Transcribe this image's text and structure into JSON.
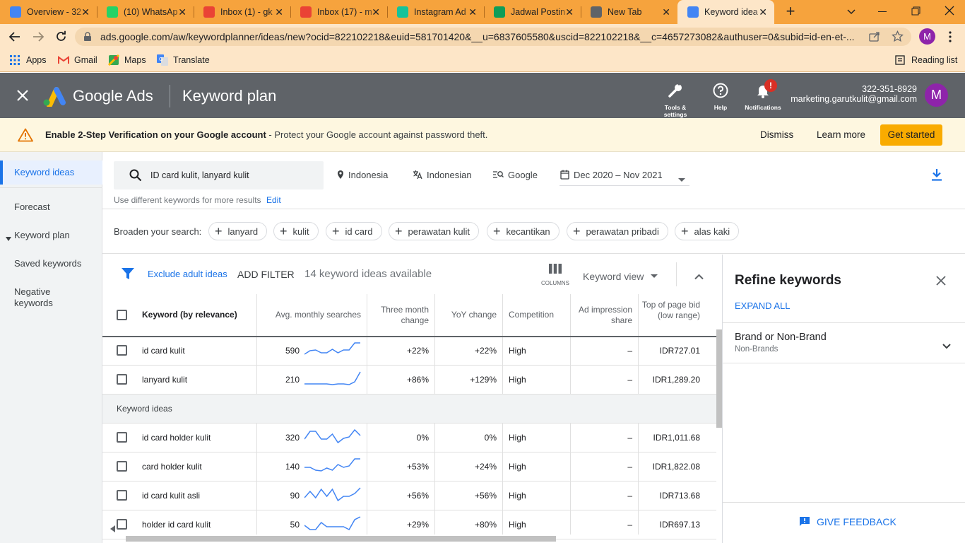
{
  "browser": {
    "tabs": [
      {
        "title": "Overview - 32",
        "favicon_color": "#4285f4"
      },
      {
        "title": "(10) WhatsAp",
        "favicon_color": "#25d366"
      },
      {
        "title": "Inbox (1) - gk",
        "favicon_color": "#ea4335"
      },
      {
        "title": "Inbox (17) - m",
        "favicon_color": "#ea4335"
      },
      {
        "title": "Instagram Ad",
        "favicon_color": "#15c39a"
      },
      {
        "title": "Jadwal Postin",
        "favicon_color": "#0f9d58"
      },
      {
        "title": "New Tab",
        "favicon_color": "#5f6368"
      },
      {
        "title": "Keyword idea",
        "favicon_color": "#4285f4"
      }
    ],
    "url": "ads.google.com/aw/keywordplanner/ideas/new?ocid=822102218&euid=581701420&__u=6837605580&uscid=822102218&__c=4657273082&authuser=0&subid=id-en-et-...",
    "profile_initial": "M",
    "bookmarks": [
      "Apps",
      "Gmail",
      "Maps",
      "Translate"
    ],
    "reading_list": "Reading list",
    "tab_strip_color": "#f6a33d"
  },
  "ads": {
    "product": "Google Ads",
    "page_title": "Keyword plan",
    "tools_label": "Tools & settings",
    "help_label": "Help",
    "notifications_label": "Notifications",
    "notifications_badge": "!",
    "customer_id": "322-351-8929",
    "email": "marketing.garutkulit@gmail.com",
    "avatar_initial": "M"
  },
  "banner": {
    "bold": "Enable 2-Step Verification on your Google account",
    "rest": " - Protect your Google account against password theft.",
    "dismiss": "Dismiss",
    "learn_more": "Learn more",
    "get_started": "Get started"
  },
  "sidebar": {
    "items": [
      "Keyword ideas",
      "Forecast",
      "Keyword plan",
      "Saved keywords",
      "Negative keywords"
    ]
  },
  "search": {
    "keywords": "ID card kulit, lanyard kulit",
    "location": "Indonesia",
    "language": "Indonesian",
    "network": "Google",
    "date_range": "Dec 2020 – Nov 2021",
    "hint": "Use different keywords for more results",
    "edit": "Edit"
  },
  "broaden": {
    "label": "Broaden your search:",
    "chips": [
      "lanyard",
      "kulit",
      "id card",
      "perawatan kulit",
      "kecantikan",
      "perawatan pribadi",
      "alas kaki"
    ]
  },
  "filters": {
    "exclude_adult": "Exclude adult ideas",
    "add_filter": "ADD FILTER",
    "count": "14 keyword ideas available",
    "columns": "COLUMNS",
    "view": "Keyword view"
  },
  "table": {
    "headers": {
      "keyword": "Keyword (by relevance)",
      "searches": "Avg. monthly searches",
      "three_month": "Three month change",
      "yoy": "YoY change",
      "competition": "Competition",
      "impression": "Ad impression share",
      "bid_low": "Top of page bid (low range)"
    },
    "section_label": "Keyword ideas",
    "provided": [
      {
        "keyword": "id card kulit",
        "searches": "590",
        "three_month": "+22%",
        "yoy": "+22%",
        "competition": "High",
        "impression": "–",
        "bid_low": "IDR727.01",
        "trend": [
          0.2,
          0.45,
          0.5,
          0.3,
          0.3,
          0.55,
          0.3,
          0.5,
          0.5,
          1.0,
          1.0
        ]
      },
      {
        "keyword": "lanyard kulit",
        "searches": "210",
        "three_month": "+86%",
        "yoy": "+129%",
        "competition": "High",
        "impression": "–",
        "bid_low": "IDR1,289.20",
        "trend": [
          0.15,
          0.15,
          0.15,
          0.15,
          0.15,
          0.1,
          0.15,
          0.15,
          0.1,
          0.3,
          1.0
        ]
      }
    ],
    "ideas": [
      {
        "keyword": "id card holder kulit",
        "searches": "320",
        "three_month": "0%",
        "yoy": "0%",
        "competition": "High",
        "impression": "–",
        "bid_low": "IDR1,011.68",
        "trend": [
          0.35,
          0.9,
          0.9,
          0.35,
          0.35,
          0.7,
          0.1,
          0.4,
          0.5,
          1.0,
          0.6
        ]
      },
      {
        "keyword": "card holder kulit",
        "searches": "140",
        "three_month": "+53%",
        "yoy": "+24%",
        "competition": "High",
        "impression": "–",
        "bid_low": "IDR1,822.08",
        "trend": [
          0.4,
          0.4,
          0.2,
          0.15,
          0.35,
          0.2,
          0.6,
          0.4,
          0.5,
          1.0,
          1.0
        ]
      },
      {
        "keyword": "id card kulit asli",
        "searches": "90",
        "three_month": "+56%",
        "yoy": "+56%",
        "competition": "High",
        "impression": "–",
        "bid_low": "IDR713.68",
        "trend": [
          0.3,
          0.75,
          0.3,
          0.9,
          0.4,
          0.9,
          0.1,
          0.4,
          0.4,
          0.6,
          1.0
        ]
      },
      {
        "keyword": "holder id card kulit",
        "searches": "50",
        "three_month": "+29%",
        "yoy": "+80%",
        "competition": "High",
        "impression": "–",
        "bid_low": "IDR697.13",
        "trend": [
          0.4,
          0.1,
          0.1,
          0.6,
          0.3,
          0.3,
          0.3,
          0.3,
          0.1,
          0.8,
          1.0
        ]
      }
    ]
  },
  "refine": {
    "title": "Refine keywords",
    "expand_all": "EXPAND ALL",
    "group_title": "Brand or Non-Brand",
    "group_sub": "Non-Brands",
    "feedback": "GIVE FEEDBACK"
  },
  "colors": {
    "accent": "#1a73e8",
    "header": "#5f6368",
    "banner_button": "#f9ab00",
    "sparkline": "#4285f4"
  }
}
